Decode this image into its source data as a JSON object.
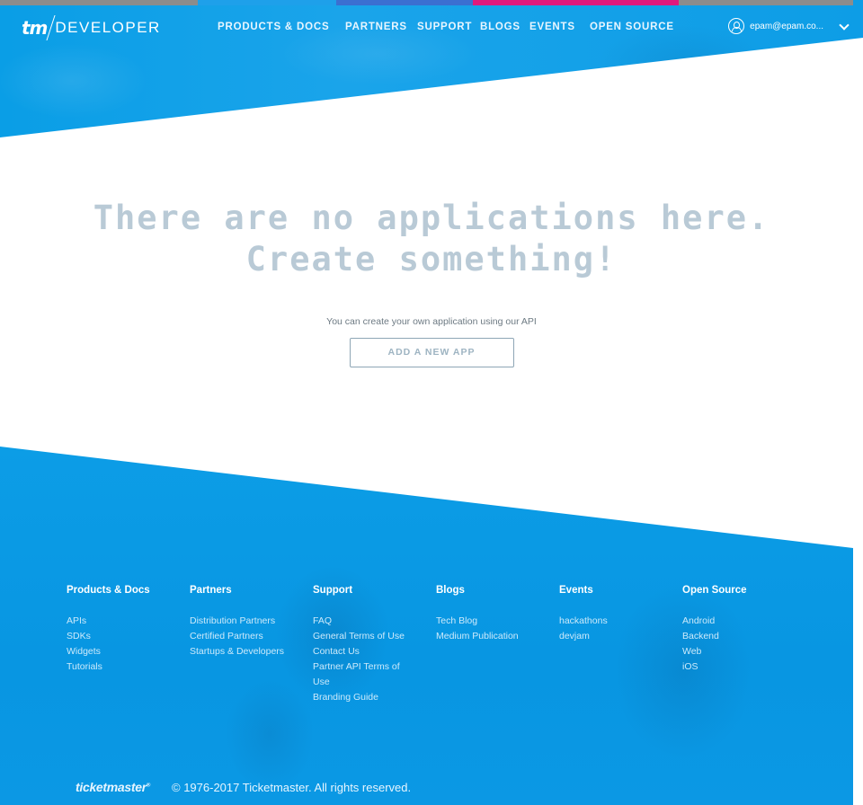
{
  "colors": {
    "accent_blue": "#0b9de6",
    "headline": "#b9cad6",
    "strip": [
      "#8c8c8c",
      "#1ea0ea",
      "#3b6fd1",
      "#e0197d",
      "#8c8c8c"
    ]
  },
  "nav": {
    "logo_tm": "tm",
    "logo_dev": "DEVELOPER",
    "links": [
      "PRODUCTS & DOCS",
      "PARTNERS",
      "SUPPORT",
      "BLOGS",
      "EVENTS",
      "OPEN SOURCE"
    ],
    "user_email": "epam@epam.co...",
    "user_icon": "user-circle-icon",
    "dropdown_icon": "chevron-down-icon"
  },
  "empty_state": {
    "line1": "There are no applications here.",
    "line2": "Create something!",
    "description": "You can create your own application using our API",
    "button": "ADD A NEW APP"
  },
  "footer": {
    "columns": [
      {
        "title": "Products & Docs",
        "items": [
          "APIs",
          "SDKs",
          "Widgets",
          "Tutorials"
        ]
      },
      {
        "title": "Partners",
        "items": [
          "Distribution Partners",
          "Certified Partners",
          "Startups & Developers"
        ]
      },
      {
        "title": "Support",
        "items": [
          "FAQ",
          "General Terms of Use",
          "Contact Us",
          "Partner API Terms of Use",
          "Branding Guide"
        ]
      },
      {
        "title": "Blogs",
        "items": [
          "Tech Blog",
          "Medium Publication"
        ]
      },
      {
        "title": "Events",
        "items": [
          "hackathons",
          "devjam"
        ]
      },
      {
        "title": "Open Source",
        "items": [
          "Android",
          "Backend",
          "Web",
          "iOS"
        ]
      }
    ],
    "brand": "ticketmaster",
    "brand_mark": "®",
    "copyright": "© 1976-2017 Ticketmaster. All rights reserved."
  }
}
